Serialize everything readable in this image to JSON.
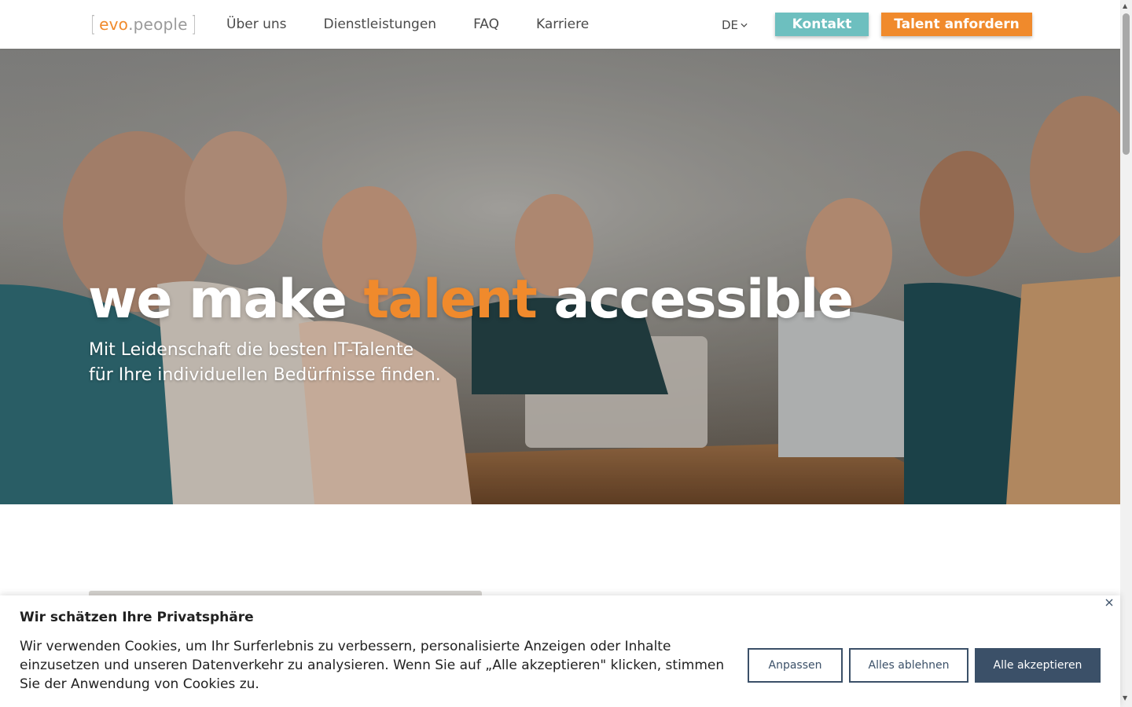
{
  "header": {
    "logo": {
      "part1": "evo",
      "part2": ".people"
    },
    "nav": [
      {
        "label": "Über uns"
      },
      {
        "label": "Dienstleistungen"
      },
      {
        "label": "FAQ"
      },
      {
        "label": "Karriere"
      }
    ],
    "language": "DE",
    "contact_button": "Kontakt",
    "request_button": "Talent anfordern"
  },
  "hero": {
    "title_pre": "we make ",
    "title_accent": "talent",
    "title_post": " accessible",
    "subtitle_line1": "Mit Leidenschaft die besten IT-Talente",
    "subtitle_line2": "für Ihre individuellen Bedürfnisse finden."
  },
  "cookie_banner": {
    "title": "Wir schätzen Ihre Privatsphäre",
    "text": "Wir verwenden Cookies, um Ihr Surferlebnis zu verbessern, personalisierte Anzeigen oder Inhalte einzusetzen und unseren Datenverkehr zu analysieren. Wenn Sie auf „Alle akzeptieren\" klicken, stimmen Sie der Anwendung von Cookies zu.",
    "customize_button": "Anpassen",
    "reject_button": "Alles ablehnen",
    "accept_button": "Alle akzeptieren"
  },
  "colors": {
    "brand_orange": "#f08a2c",
    "brand_teal": "#6dbfbf",
    "cookie_navy": "#3b5068"
  },
  "icons": {
    "language_dropdown": "chevron-down-icon",
    "cookie_close": "close-icon"
  }
}
